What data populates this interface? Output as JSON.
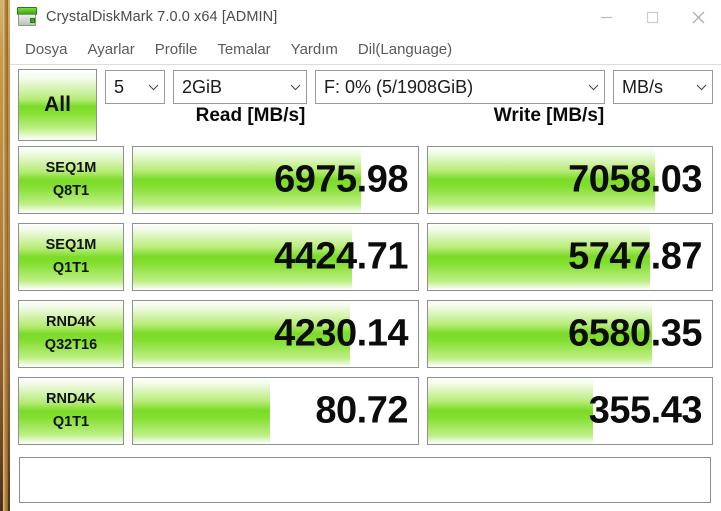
{
  "window": {
    "title": "CrystalDiskMark 7.0.0 x64 [ADMIN]",
    "app_icon": "disk-drive-icon",
    "minimize_label": "—",
    "maximize_label": "□",
    "close_label": "✕"
  },
  "menu": {
    "items": [
      {
        "label": "Dosya"
      },
      {
        "label": "Ayarlar"
      },
      {
        "label": "Profile"
      },
      {
        "label": "Temalar"
      },
      {
        "label": "Yardım"
      },
      {
        "label": "Dil(Language)"
      }
    ]
  },
  "toolbar": {
    "all_button_label": "All",
    "runs": {
      "value": "5"
    },
    "test_size": {
      "value": "2GiB"
    },
    "drive": {
      "value": "F: 0% (5/1908GiB)"
    },
    "unit": {
      "value": "MB/s"
    }
  },
  "columns": {
    "read_header": "Read [MB/s]",
    "write_header": "Write [MB/s]"
  },
  "colors": {
    "accent_green": "#7bdb28",
    "bar_border": "#909090",
    "title_text": "#4a4a4a"
  },
  "chart_data": {
    "type": "bar",
    "title": "CrystalDiskMark 7.0.0 x64 benchmark results",
    "xlabel": "",
    "ylabel": "MB/s",
    "unit": "MB/s",
    "categories": [
      "SEQ1M Q8T1",
      "SEQ1M Q1T1",
      "RND4K Q32T16",
      "RND4K Q1T1"
    ],
    "series": [
      {
        "name": "Read [MB/s]",
        "values": [
          6975.98,
          4424.71,
          4230.14,
          80.72
        ]
      },
      {
        "name": "Write [MB/s]",
        "values": [
          7058.03,
          5747.87,
          6580.35,
          355.43
        ]
      }
    ],
    "legend_position": "top",
    "grid": false
  },
  "rows": [
    {
      "name_line1": "SEQ1M",
      "name_line2": "Q8T1",
      "read": {
        "value": "6975.98",
        "fill_percent": 80
      },
      "write": {
        "value": "7058.03",
        "fill_percent": 80
      }
    },
    {
      "name_line1": "SEQ1M",
      "name_line2": "Q1T1",
      "read": {
        "value": "4424.71",
        "fill_percent": 77
      },
      "write": {
        "value": "5747.87",
        "fill_percent": 78
      }
    },
    {
      "name_line1": "RND4K",
      "name_line2": "Q32T16",
      "read": {
        "value": "4230.14",
        "fill_percent": 76
      },
      "write": {
        "value": "6580.35",
        "fill_percent": 79
      }
    },
    {
      "name_line1": "RND4K",
      "name_line2": "Q1T1",
      "read": {
        "value": "80.72",
        "fill_percent": 48
      },
      "write": {
        "value": "355.43",
        "fill_percent": 58
      }
    }
  ],
  "comment_box": {
    "value": ""
  }
}
